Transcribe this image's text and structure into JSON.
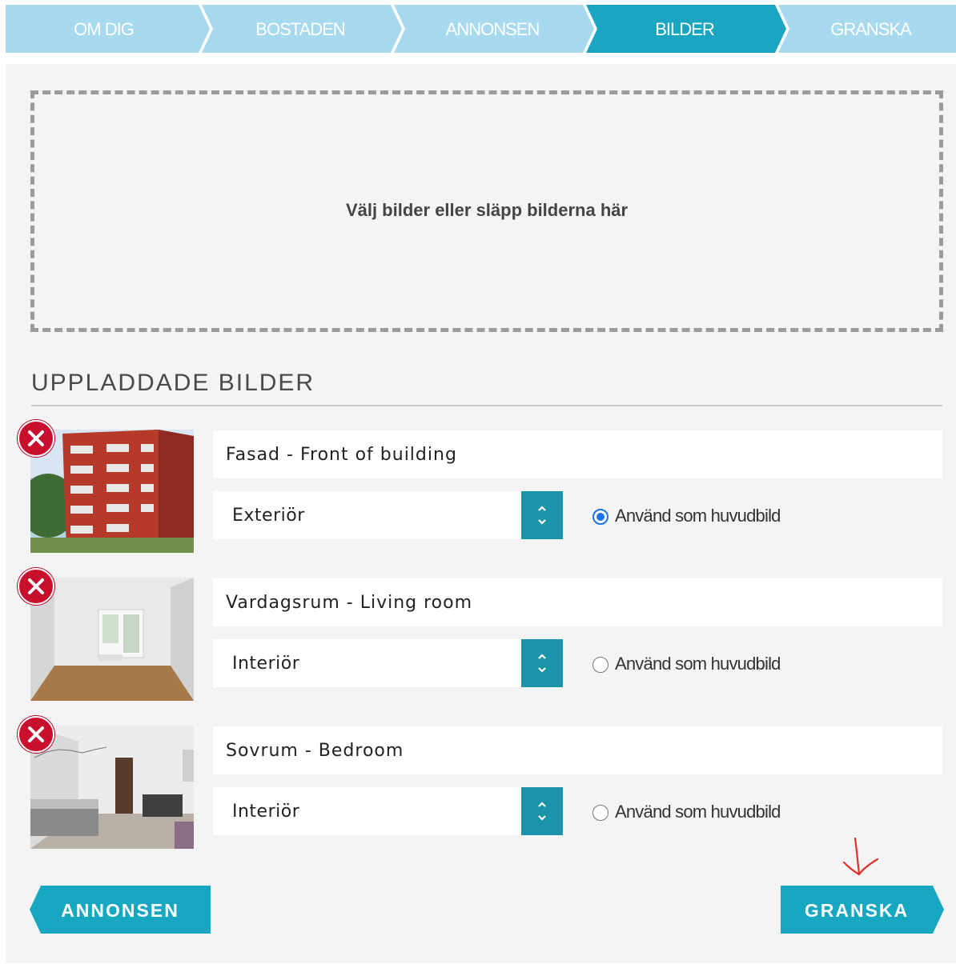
{
  "steps": [
    {
      "label": "OM DIG",
      "active": false
    },
    {
      "label": "BOSTADEN",
      "active": false
    },
    {
      "label": "ANNONSEN",
      "active": false
    },
    {
      "label": "BILDER",
      "active": true
    },
    {
      "label": "GRANSKA",
      "active": false
    }
  ],
  "colors": {
    "step_inactive": "#a8daef",
    "step_active": "#1aa5c3",
    "accent": "#1b93a8",
    "button": "#17a7c0",
    "remove": "#c8102e",
    "annotation": "#e0302a"
  },
  "dropzone": {
    "text": "Välj bilder eller släpp bilderna här"
  },
  "uploaded": {
    "title": "UPPLADDADE BILDER",
    "items": [
      {
        "caption": "Fasad - Front of building",
        "category": "Exteriör",
        "main_label": "Använd som huvudbild",
        "is_main": true,
        "thumb_icon": "building-photo"
      },
      {
        "caption": "Vardagsrum - Living room",
        "category": "Interiör",
        "main_label": "Använd som huvudbild",
        "is_main": false,
        "thumb_icon": "living-room-photo"
      },
      {
        "caption": "Sovrum - Bedroom",
        "category": "Interiör",
        "main_label": "Använd som huvudbild",
        "is_main": false,
        "thumb_icon": "bedroom-photo"
      }
    ]
  },
  "nav": {
    "back_label": "ANNONSEN",
    "next_label": "GRANSKA"
  }
}
